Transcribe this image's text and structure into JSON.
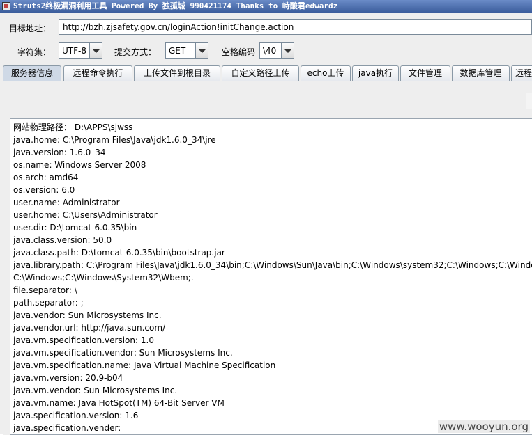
{
  "window": {
    "title": "Struts2终极漏洞利用工具   Powered By 独孤城 990421174 Thanks to 峙酸君edwardz"
  },
  "form": {
    "target_label": "目标地址：",
    "target_value": "http://bzh.zjsafety.gov.cn/loginAction!initChange.action",
    "charset_label": "字符集：",
    "charset_value": "UTF-8",
    "method_label": "提交方式：",
    "method_value": "GET",
    "space_label": "空格编码",
    "space_value": "\\40"
  },
  "tabs": [
    {
      "label": "服务器信息",
      "active": true
    },
    {
      "label": "远程命令执行"
    },
    {
      "label": "上传文件到根目录"
    },
    {
      "label": "自定义路径上传"
    },
    {
      "label": "echo上传"
    },
    {
      "label": "java执行"
    },
    {
      "label": "文件管理"
    },
    {
      "label": "数据库管理"
    },
    {
      "label": "远程"
    }
  ],
  "output_lines": [
    "网站物理路径： D:\\APPS\\sjwss",
    "java.home: C:\\Program Files\\Java\\jdk1.6.0_34\\jre",
    "java.version: 1.6.0_34",
    "os.name: Windows Server 2008",
    "os.arch: amd64",
    "os.version: 6.0",
    "user.name: Administrator",
    "user.home: C:\\Users\\Administrator",
    "user.dir: D:\\tomcat-6.0.35\\bin",
    "java.class.version: 50.0",
    "java.class.path: D:\\tomcat-6.0.35\\bin\\bootstrap.jar",
    "java.library.path: C:\\Program Files\\Java\\jdk1.6.0_34\\bin;C:\\Windows\\Sun\\Java\\bin;C:\\Windows\\system32;C:\\Windows;C:\\Windows\\system",
    "C:\\Windows;C:\\Windows\\System32\\Wbem;.",
    "file.separator: \\",
    "path.separator: ;",
    "java.vendor: Sun Microsystems Inc.",
    "java.vendor.url: http://java.sun.com/",
    "java.vm.specification.version: 1.0",
    "java.vm.specification.vendor: Sun Microsystems Inc.",
    "java.vm.specification.name: Java Virtual Machine Specification",
    "java.vm.version: 20.9-b04",
    "java.vm.vendor: Sun Microsystems Inc.",
    "java.vm.name: Java HotSpot(TM) 64-Bit Server VM",
    "java.specification.version: 1.6",
    "java.specification.vender:"
  ],
  "watermark": "www.wooyun.org",
  "icons": {
    "app": "app-icon",
    "dropdown": "chevron-down-icon"
  },
  "colors": {
    "titlebar": "#3b5d9c",
    "active_tab": "#cfd9e6",
    "panel": "#eeeeee"
  }
}
